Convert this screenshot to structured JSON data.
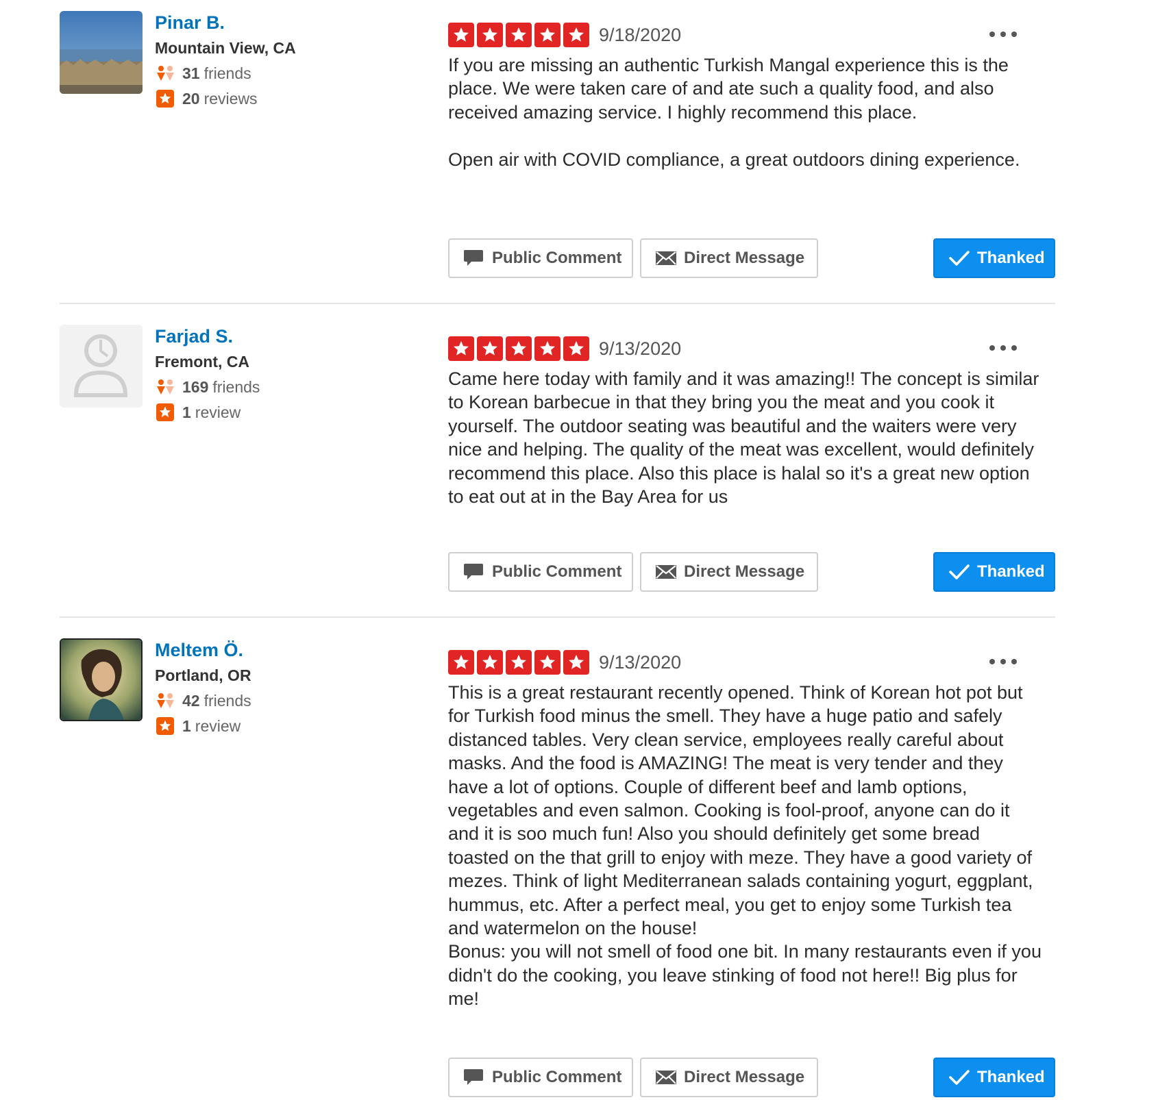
{
  "colors": {
    "link": "#0073bb",
    "star": "#e12525",
    "thanked": "#0d8ff0",
    "stat_icon": "#f15c00"
  },
  "reviews": [
    {
      "user": {
        "name": "Pinar B.",
        "location": "Mountain View, CA",
        "friends_count": "31",
        "friends_label": "friends",
        "reviews_count": "20",
        "reviews_label": "reviews",
        "avatar": "landscape-photo"
      },
      "rating": 5,
      "date": "9/18/2020",
      "text": "If you are missing an authentic Turkish Mangal experience this is the place. We were taken care of and ate such a quality food, and also received amazing service. I highly recommend this place.\n\nOpen air with COVID compliance, a great outdoors dining experience.",
      "buttons": {
        "comment": "Public Comment",
        "message": "Direct Message",
        "thanked": "Thanked"
      }
    },
    {
      "user": {
        "name": "Farjad S.",
        "location": "Fremont, CA",
        "friends_count": "169",
        "friends_label": "friends",
        "reviews_count": "1",
        "reviews_label": "review",
        "avatar": "default-avatar"
      },
      "rating": 5,
      "date": "9/13/2020",
      "text": "Came here today with family and it was amazing!! The concept is similar to Korean barbecue in that they bring you the meat and you cook it yourself. The outdoor seating was beautiful and the waiters were very nice and helping. The quality of the meat was excellent, would definitely recommend this place. Also this place is halal so it's a great new option to eat out at in the Bay Area for us",
      "buttons": {
        "comment": "Public Comment",
        "message": "Direct Message",
        "thanked": "Thanked"
      }
    },
    {
      "user": {
        "name": "Meltem Ö.",
        "location": "Portland, OR",
        "friends_count": "42",
        "friends_label": "friends",
        "reviews_count": "1",
        "reviews_label": "review",
        "avatar": "portrait-photo"
      },
      "rating": 5,
      "date": "9/13/2020",
      "text": "This is a great restaurant recently opened. Think of Korean hot pot but for Turkish food minus the smell. They have a huge patio and safely distanced tables. Very clean service, employees really careful about masks. And the food is AMAZING! The meat is very tender and they have a lot of options. Couple of different beef and lamb options, vegetables and even salmon. Cooking is fool-proof, anyone can do it and it is soo much fun! Also you should definitely get some bread toasted on the that grill to enjoy with meze. They have a good variety of mezes. Think of light Mediterranean salads containing yogurt, eggplant, hummus, etc. After a perfect meal, you get to enjoy some Turkish tea and watermelon on the house!\nBonus: you will not smell of food one bit. In many restaurants even if you didn't do the cooking, you leave stinking of food not here!! Big plus for me!",
      "buttons": {
        "comment": "Public Comment",
        "message": "Direct Message",
        "thanked": "Thanked"
      }
    }
  ]
}
